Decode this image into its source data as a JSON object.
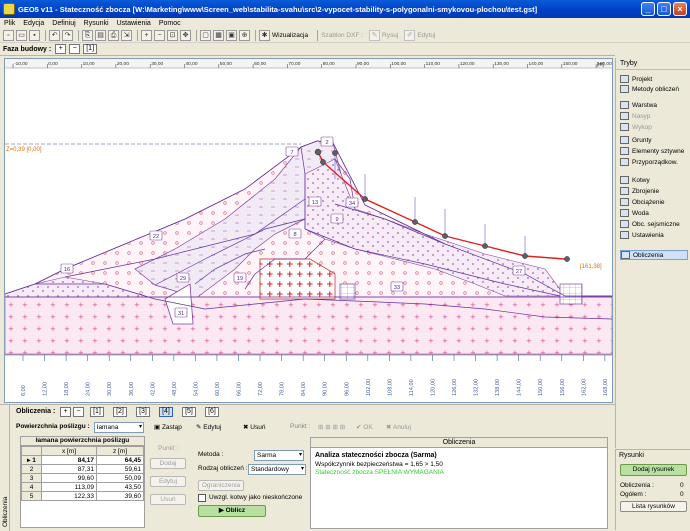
{
  "window": {
    "title": "GEO5 v11 - Stateczność zbocza [W:\\Marketing\\www\\Screen_web\\stabilita-svahu\\src\\2-vypocet-stability-s-polygonalni-smykovou-plochou\\test.gst]"
  },
  "menu": [
    "Plik",
    "Edycja",
    "Definiuj",
    "Rysunki",
    "Ustawienia",
    "Pomoc"
  ],
  "toolbar": {
    "wizualizacja": "Wizualizacja",
    "szablon": "Szablon DXF :",
    "rysuj": "Rysuj",
    "edytuj": "Edytuj"
  },
  "phase": {
    "label": "Faza budowy :",
    "current": "[1]"
  },
  "ruler": {
    "top_ticks": [
      "-10,00",
      "0,00",
      "10,00",
      "20,00",
      "30,00",
      "40,00",
      "50,00",
      "60,00",
      "70,00",
      "80,00",
      "90,00",
      "100,00",
      "110,00",
      "120,00",
      "130,00",
      "140,00",
      "150,00",
      "160,00"
    ],
    "unit": "[m]",
    "bottom_ticks": [
      "6,00",
      "12,00",
      "18,00",
      "24,00",
      "30,00",
      "36,00",
      "42,00",
      "48,00",
      "54,00",
      "60,00",
      "66,00",
      "72,00",
      "78,00",
      "84,00",
      "90,00",
      "96,00",
      "102,00",
      "108,00",
      "114,00",
      "120,00",
      "126,00",
      "132,00",
      "138,00",
      "144,00",
      "150,00",
      "156,00",
      "162,00",
      "168,00"
    ]
  },
  "canvas": {
    "left_label": "Z=0,39 [0,00]",
    "right_label": "[161,38]",
    "region_labels": [
      "16",
      "29",
      "19",
      "31",
      "27",
      "33",
      "13",
      "22",
      "34",
      "8",
      "7",
      "2",
      "9"
    ]
  },
  "tryby": {
    "title": "Tryby",
    "items": [
      {
        "label": "Projekt",
        "enabled": true
      },
      {
        "label": "Metody obliczeń",
        "enabled": true
      },
      {
        "label": "Warstwa",
        "enabled": true
      },
      {
        "label": "Nasyp",
        "enabled": false
      },
      {
        "label": "Wykop",
        "enabled": false
      },
      {
        "label": "Grunty",
        "enabled": true
      },
      {
        "label": "Elementy sztywne",
        "enabled": true
      },
      {
        "label": "Przyporządkow.",
        "enabled": true
      },
      {
        "label": "Kotwy",
        "enabled": true
      },
      {
        "label": "Zbrojenie",
        "enabled": true
      },
      {
        "label": "Obciążenie",
        "enabled": true
      },
      {
        "label": "Woda",
        "enabled": true
      },
      {
        "label": "Obc. sejsmiczne",
        "enabled": true
      },
      {
        "label": "Ustawienia",
        "enabled": true
      },
      {
        "label": "Obliczenia",
        "enabled": true,
        "active": true
      }
    ]
  },
  "rysunki": {
    "title": "Rysunki",
    "add_button": "Dodaj rysunek",
    "obliczenia_label": "Obliczenia :",
    "obliczenia_value": "0",
    "ogolem_label": "Ogółem :",
    "ogolem_value": "0",
    "list_button": "Lista rysunków"
  },
  "bottom": {
    "side_tab": "Obliczenia",
    "obliczenia_label": "Obliczenia :",
    "calc_tabs": [
      "[1]",
      "[2]",
      "[3]",
      "[4]",
      "[5]",
      "[6]"
    ],
    "active_calc_tab": "[4]",
    "surface_label": "Powierzchnia poślizgu :",
    "surface_value": "łamana",
    "zastap": "Zastąp",
    "edytuj": "Edytuj",
    "usun": "Usuń",
    "punkt_label": "Punkt :",
    "ok": "OK",
    "anuluj": "Anuluj",
    "table_title": "łamana powierzchnia poślizgu",
    "table_headers": [
      "x [m]",
      "z [m]"
    ],
    "table_rows": [
      {
        "idx": "1",
        "x": "84,17",
        "z": "64,45"
      },
      {
        "idx": "2",
        "x": "87,31",
        "z": "59,61"
      },
      {
        "idx": "3",
        "x": "99,60",
        "z": "50,09"
      },
      {
        "idx": "4",
        "x": "113,09",
        "z": "43,50"
      },
      {
        "idx": "5",
        "x": "122,33",
        "z": "39,60"
      }
    ],
    "punkt_heading": "Punkt :",
    "punkt_dodaj": "Dodaj",
    "punkt_edytuj": "Edytuj",
    "punkt_usun": "Usuń",
    "metoda_label": "Metoda :",
    "metoda_value": "Sarma",
    "rodzaj_label": "Rodzaj obliczeń :",
    "rodzaj_value": "Standardowy",
    "ograniczenia": "Ograniczenia",
    "checkbox_label": "Uwzgl. kotwy jako nieskończone",
    "oblicz": "Oblicz"
  },
  "result": {
    "heading": "Obliczenia",
    "line1": "Analiza stateczności zbocza (Sarma)",
    "line2": "Współczynnik bezpieczeństwa = 1,65 > 1,50",
    "line3": "Stateczność zbocza SPEŁNIA WYMAGANIA",
    "ok_color": "#33cc33"
  }
}
